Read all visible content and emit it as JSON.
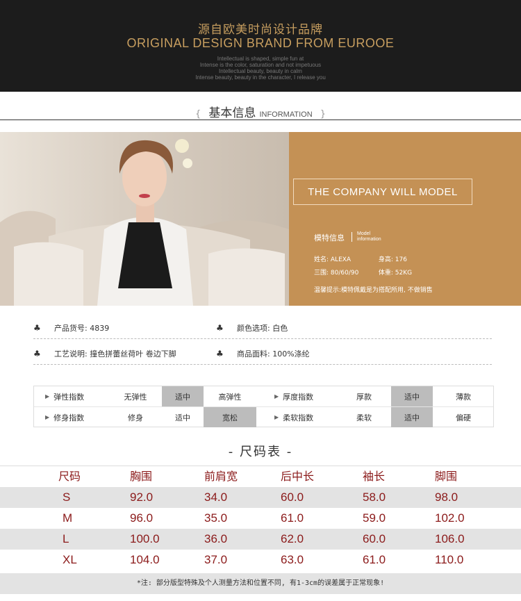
{
  "banner": {
    "title_zh": "源自欧美时尚设计品牌",
    "title_en": "ORIGINAL DESIGN BRAND FROM EUROOE",
    "lines": [
      "Intellectual is shaped, simple fun at",
      "Intense is the color, saturation and not impetuous",
      "Intellectual beauty, beauty in calm",
      "Intense beauty, beauty in the character, I release you"
    ]
  },
  "section": {
    "brace_left": "{",
    "title_zh": "基本信息",
    "title_en": "INFORMATION",
    "brace_right": "}"
  },
  "model": {
    "panel_title": "THE COMPANY WILL MODEL",
    "info_label": "模特信息",
    "info_en_1": "Model",
    "info_en_2": "information",
    "name_label": "姓名: ALEXA",
    "height_label": "身高: 176",
    "measure_label": "三围: 80/60/90",
    "weight_label": "体重:  52KG",
    "tip": "温馨提示:模特佩戴是为搭配所用, 不做销售"
  },
  "product": {
    "item_no": "产品货号: 4839",
    "color": "颜色选项: 白色",
    "craft": "工艺说明:   撞色拼蕾丝荷叶 卷边下脚",
    "fabric": "商品面料: 100%涤纶",
    "clover": "♣"
  },
  "attributes": {
    "rows": [
      {
        "left_label": "弹性指数",
        "left_opts": [
          "无弹性",
          "适中",
          "高弹性"
        ],
        "left_sel": 1,
        "right_label": "厚度指数",
        "right_opts": [
          "厚款",
          "适中",
          "薄款"
        ],
        "right_sel": 1
      },
      {
        "left_label": "修身指数",
        "left_opts": [
          "修身",
          "适中",
          "宽松"
        ],
        "left_sel": 2,
        "right_label": "柔软指数",
        "right_opts": [
          "柔软",
          "适中",
          "偏硬"
        ],
        "right_sel": 1
      }
    ]
  },
  "size_chart": {
    "title": "- 尺码表 -",
    "headers": [
      "尺码",
      "胸围",
      "前肩宽",
      "后中长",
      "袖长",
      "脚围"
    ],
    "rows": [
      [
        "S",
        "92.0",
        "34.0",
        "60.0",
        "58.0",
        "98.0"
      ],
      [
        "M",
        "96.0",
        "35.0",
        "61.0",
        "59.0",
        "102.0"
      ],
      [
        "L",
        "100.0",
        "36.0",
        "62.0",
        "60.0",
        "106.0"
      ],
      [
        "XL",
        "104.0",
        "37.0",
        "63.0",
        "61.0",
        "110.0"
      ]
    ],
    "note": "*注: 部分版型特殊及个人测量方法和位置不同, 有1-3cm的误差属于正常现象!"
  },
  "colors": {
    "gold": "#c49155",
    "dark": "#1c1c1c",
    "size_text": "#8b1a1a",
    "highlight": "#bcbcbc"
  }
}
